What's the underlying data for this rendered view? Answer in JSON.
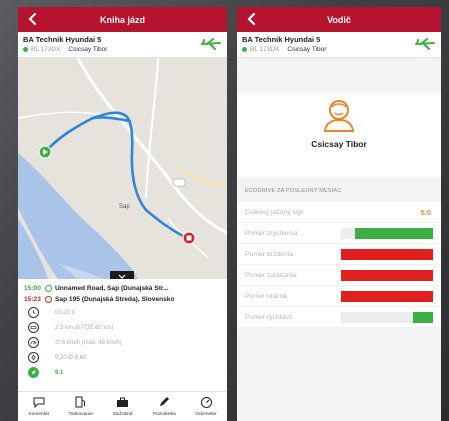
{
  "left": {
    "title": "Kniha jázd",
    "vehicle": {
      "name": "BA Technik Hyundai 5",
      "plate": "BL 173DX",
      "driver": "Csicsay Tibor"
    },
    "map": {
      "town": "Sap"
    },
    "trip": {
      "start": {
        "time": "15:00",
        "place": "Unnamed Road, Sap (Dunajská Str..."
      },
      "end": {
        "time": "15:23",
        "place": "Sap 195 (Dunajská Streda), Slovensko"
      },
      "stats": [
        {
          "icon": "clock-icon",
          "value": "00:23 h"
        },
        {
          "icon": "odometer-icon",
          "value": "2,3 km  (67732,62 km)"
        },
        {
          "icon": "speed-icon",
          "value": "∅ 6 km/h  (max. 48 km/h)"
        },
        {
          "icon": "fuel-icon",
          "value": "0,20  Ø 8,60"
        },
        {
          "icon": "eco-score-icon",
          "value": "9.1"
        }
      ]
    },
    "tabs": [
      {
        "label": "Komentár",
        "icon": "comment-icon"
      },
      {
        "label": "Tankovanie",
        "icon": "fuel-pump-icon"
      },
      {
        "label": "Služobná",
        "icon": "briefcase-icon"
      },
      {
        "label": "Poznámka",
        "icon": "pencil-icon"
      },
      {
        "label": "Odometer",
        "icon": "odometer-icon"
      }
    ]
  },
  "right": {
    "title": "Vodič",
    "vehicle": {
      "name": "BA Technik Hyundai 5",
      "plate": "BL 173DX",
      "driver": "Csicsay Tibor"
    },
    "driver_name": "Csicsay Tibor",
    "section_title": "ECODRIVE ZA POSLEDNÝ MESIAC",
    "overall": {
      "label": "Celkový jazdný štýl:",
      "score": "5.0"
    },
    "metrics": [
      {
        "label": "Pomer zrýchlenia:",
        "level": 0.85,
        "color": "#3cb044"
      },
      {
        "label": "Pomer brzdenia:",
        "level": 1.0,
        "color": "#e0201f"
      },
      {
        "label": "Pomer zatáčania:",
        "level": 1.0,
        "color": "#e0201f"
      },
      {
        "label": "Pomer otáčok:",
        "level": 1.0,
        "color": "#e0201f"
      },
      {
        "label": "Pomer rýchlosti:",
        "level": 0.22,
        "color": "#3cb044"
      }
    ]
  },
  "colors": {
    "header": "#b5132e",
    "green": "#3cb044",
    "red": "#e0201f",
    "orange": "#e8862a"
  }
}
